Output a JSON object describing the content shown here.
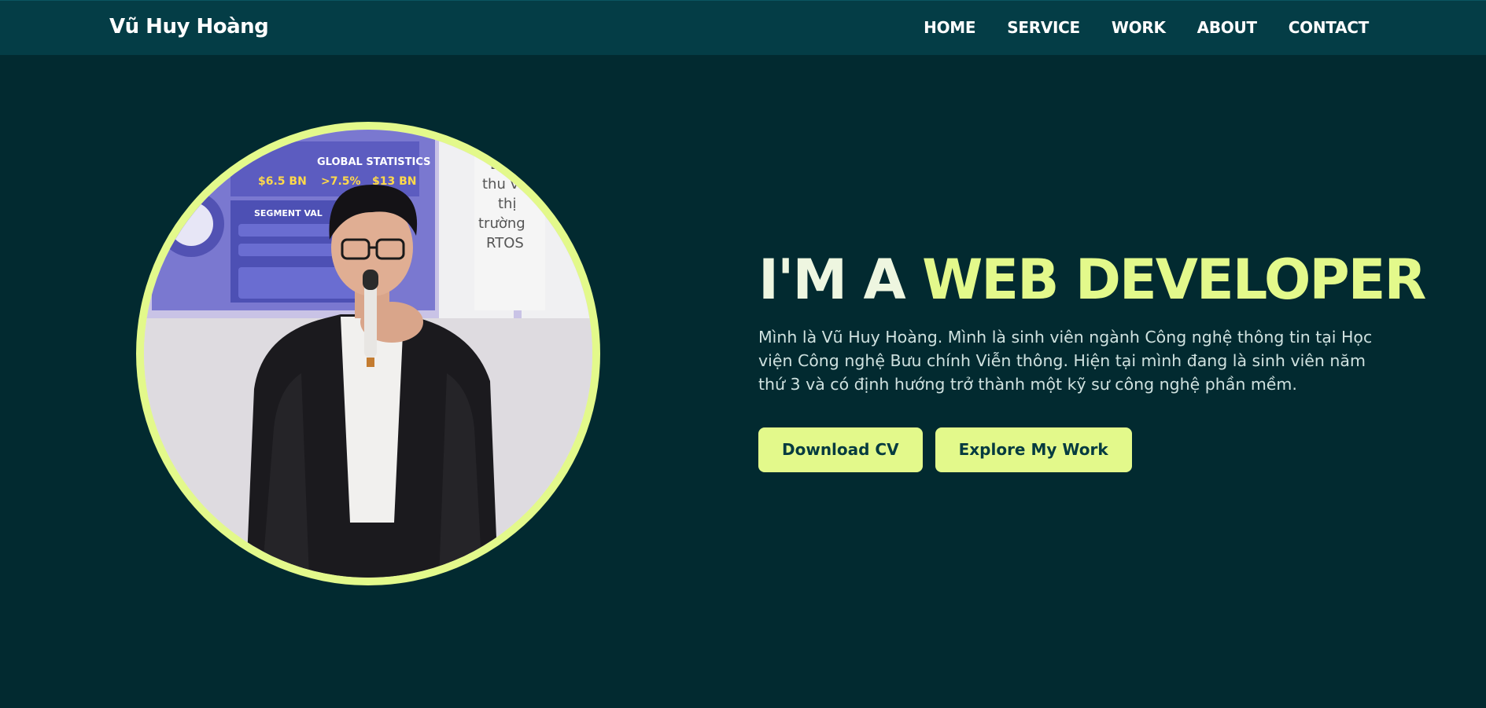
{
  "nav": {
    "brand": "Vũ Huy Hoàng",
    "links": [
      "HOME",
      "SERVICE",
      "WORK",
      "ABOUT",
      "CONTACT"
    ]
  },
  "hero": {
    "title_prefix": "I'M A ",
    "title_accent": "WEB DEVELOPER",
    "description": "Mình là Vũ Huy Hoàng. Mình là sinh viên ngành Công nghệ thông tin tại Học viện Công nghệ Bưu chính Viễn thông. Hiện tại mình đang là sinh viên năm thứ 3 và có định hướng trở thành một kỹ sư công nghệ phần mềm.",
    "buttons": {
      "download": "Download CV",
      "explore": "Explore My Work"
    },
    "photo": {
      "slide_heading": "GLOBAL STATISTICS",
      "slide_segment": "SEGMENT VAL",
      "slide_stats": [
        "$6.5 BN",
        ">7.5%",
        "$13 BN"
      ],
      "slide_side_text": [
        "Dự",
        "thu và",
        "thị",
        "trường",
        "RTOS"
      ]
    }
  },
  "colors": {
    "background": "#022a30",
    "navbar": "#043d46",
    "accent": "#e3f98b",
    "button_text": "#053b40"
  }
}
